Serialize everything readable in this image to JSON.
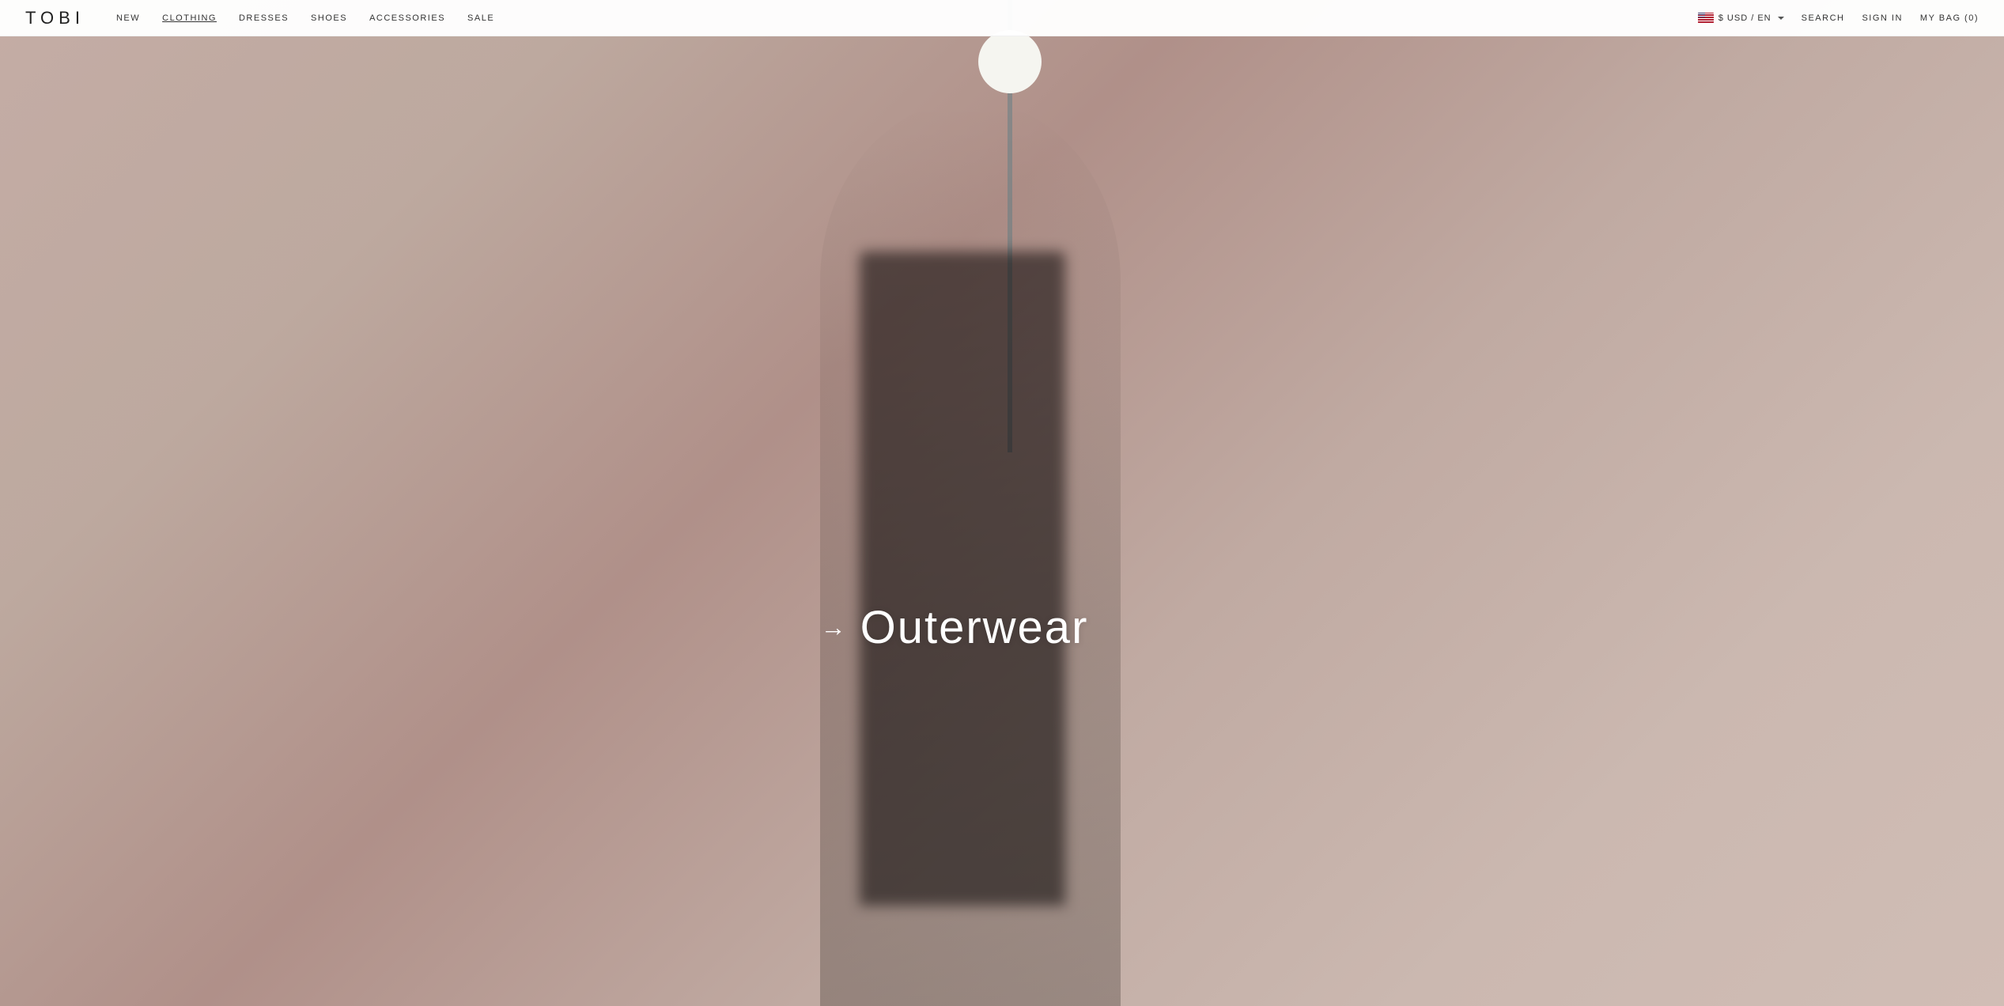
{
  "header": {
    "logo": "TOBI",
    "nav": {
      "items": [
        {
          "label": "NEW",
          "key": "new"
        },
        {
          "label": "CLOTHING",
          "key": "clothing",
          "active": true
        },
        {
          "label": "DRESSES",
          "key": "dresses"
        },
        {
          "label": "SHOES",
          "key": "shoes"
        },
        {
          "label": "ACCESSORIES",
          "key": "accessories"
        },
        {
          "label": "SALE",
          "key": "sale"
        }
      ]
    },
    "currency_label": "$ USD / EN",
    "chevron": "▾",
    "search_label": "SEARCH",
    "signin_label": "SIGN IN",
    "bag_label": "MY BAG (0)"
  },
  "hero": {
    "arrow": "→",
    "cta_text": "Outerwear"
  }
}
